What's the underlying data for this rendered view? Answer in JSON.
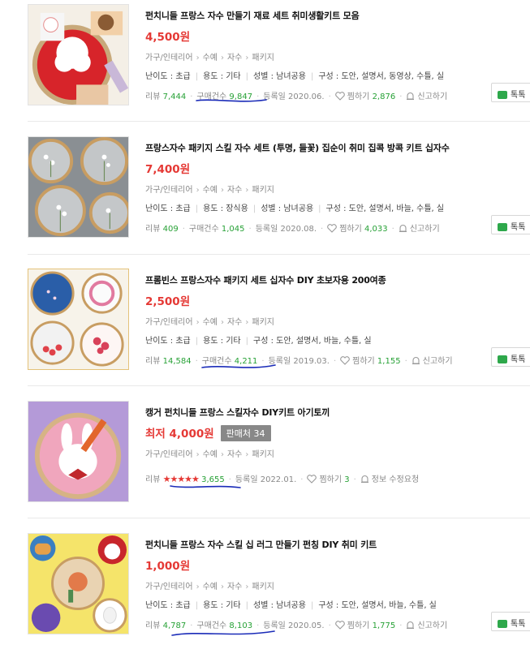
{
  "colors": {
    "price": "#e53935",
    "count_green": "#27a136",
    "talk_green": "#2ea84b",
    "annotation_pen": "#1a2bb8"
  },
  "labels": {
    "review": "리뷰",
    "purchase": "구매건수",
    "registered": "등록일",
    "wish": "찜하기",
    "report": "신고하기",
    "info_edit": "정보 수정요청",
    "talk": "톡톡"
  },
  "products": [
    {
      "title": "펀치니들 프랑스 자수 만들기 재료 세트 취미생활키트 모음",
      "price": "4,500원",
      "category": [
        "가구/인테리어",
        "수예",
        "자수",
        "패키지"
      ],
      "specs": [
        "난이도 : 초급",
        "용도 : 기타",
        "성별 : 남녀공용",
        "구성 : 도안, 설명서, 동영상, 수틀, 실"
      ],
      "reviews": "7,444",
      "purchases": "9,847",
      "date": "2020.06.",
      "wishes": "2,876"
    },
    {
      "title": "프랑스자수 패키지 스킬 자수 세트 (투명, 들꽃) 집순이 취미 집콕 방콕 키트 십자수",
      "price": "7,400원",
      "category": [
        "가구/인테리어",
        "수예",
        "자수",
        "패키지"
      ],
      "specs": [
        "난이도 : 초급",
        "용도 : 장식용",
        "성별 : 남녀공용",
        "구성 : 도안, 설명서, 바늘, 수틀, 실"
      ],
      "reviews": "409",
      "purchases": "1,045",
      "date": "2020.08.",
      "wishes": "4,033"
    },
    {
      "title": "프롬빈스 프랑스자수 패키지 세트 십자수 DIY 초보자용 200여종",
      "price": "2,500원",
      "category": [
        "가구/인테리어",
        "수예",
        "자수",
        "패키지"
      ],
      "specs": [
        "난이도 : 초급",
        "용도 : 기타",
        "구성 : 도안, 설명서, 바늘, 수틀, 실"
      ],
      "reviews": "14,584",
      "purchases": "4,211",
      "date": "2019.03.",
      "wishes": "1,155"
    },
    {
      "title": "캥거 펀치니들 프랑스 스킬자수 DIY키트 아기토끼",
      "price": "최저 4,000원",
      "seller_badge": "판매처 34",
      "category": [
        "가구/인테리어",
        "수예",
        "자수",
        "패키지"
      ],
      "rating_stars": 5,
      "reviews": "3,655",
      "date": "2022.01.",
      "wishes": "3"
    },
    {
      "title": "펀치니들 프랑스 자수 스킬 십 러그 만들기 펀칭 DIY 취미 키트",
      "price": "1,000원",
      "category": [
        "가구/인테리어",
        "수예",
        "자수",
        "패키지"
      ],
      "specs": [
        "난이도 : 초급",
        "용도 : 기타",
        "성별 : 남녀공용",
        "구성 : 도안, 설명서, 바늘, 수틀, 실"
      ],
      "reviews": "4,787",
      "purchases": "8,103",
      "date": "2020.05.",
      "wishes": "1,775"
    }
  ]
}
